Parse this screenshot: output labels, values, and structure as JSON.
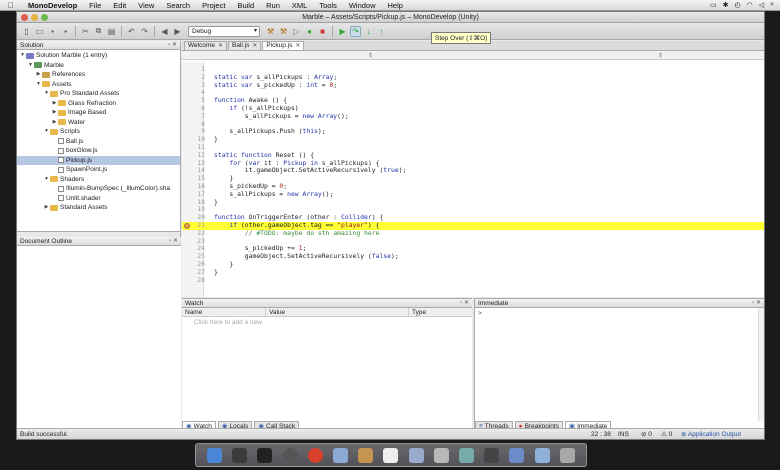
{
  "menubar": {
    "app": "MonoDevelop",
    "items": [
      "File",
      "Edit",
      "View",
      "Search",
      "Project",
      "Build",
      "Run",
      "XML",
      "Tools",
      "Window",
      "Help"
    ]
  },
  "window": {
    "title": "Marble – Assets/Scripts/Pickup.js – MonoDevelop (Unity)"
  },
  "toolbar": {
    "config": "Debug",
    "tooltip": "Step Over (⇧⌘O)"
  },
  "solution_pane": {
    "title": "Solution",
    "tree": [
      {
        "label": "Solution Marble (1 entry)",
        "depth": 0,
        "icon": "solution",
        "arrow": "▼"
      },
      {
        "label": "Marble",
        "depth": 1,
        "icon": "project",
        "arrow": "▼"
      },
      {
        "label": "References",
        "depth": 2,
        "icon": "references",
        "arrow": "▶"
      },
      {
        "label": "Assets",
        "depth": 2,
        "icon": "folder",
        "arrow": "▼"
      },
      {
        "label": "Pro Standard Assets",
        "depth": 3,
        "icon": "folder",
        "arrow": "▼"
      },
      {
        "label": "Glass Refraction",
        "depth": 4,
        "icon": "folder",
        "arrow": "▶"
      },
      {
        "label": "Image Based",
        "depth": 4,
        "icon": "folder",
        "arrow": "▶"
      },
      {
        "label": "Water",
        "depth": 4,
        "icon": "folder",
        "arrow": "▶"
      },
      {
        "label": "Scripts",
        "depth": 3,
        "icon": "folder",
        "arrow": "▼"
      },
      {
        "label": "Ball.js",
        "depth": 4,
        "icon": "file",
        "arrow": ""
      },
      {
        "label": "boxGlow.js",
        "depth": 4,
        "icon": "file",
        "arrow": ""
      },
      {
        "label": "Pickup.js",
        "depth": 4,
        "icon": "file",
        "arrow": "",
        "selected": true
      },
      {
        "label": "SpawnPoint.js",
        "depth": 4,
        "icon": "file",
        "arrow": ""
      },
      {
        "label": "Shaders",
        "depth": 3,
        "icon": "folder",
        "arrow": "▼"
      },
      {
        "label": "Illumin-BumpSpec (_IllumColor).sha",
        "depth": 4,
        "icon": "file",
        "arrow": ""
      },
      {
        "label": "Unlit.shader",
        "depth": 4,
        "icon": "file",
        "arrow": ""
      },
      {
        "label": "Standard Assets",
        "depth": 3,
        "icon": "folder",
        "arrow": "▶"
      }
    ]
  },
  "outline_pane": {
    "title": "Document Outline"
  },
  "editor": {
    "tabs": [
      {
        "label": "Welcome",
        "active": false
      },
      {
        "label": "Ball.js",
        "active": false
      },
      {
        "label": "Pickup.js",
        "active": true
      }
    ],
    "lines": [
      {
        "n": "1",
        "t": ""
      },
      {
        "n": "2",
        "t": "static var s_allPickups : Array;"
      },
      {
        "n": "3",
        "t": "static var s_pickedUp : int = 0;"
      },
      {
        "n": "4",
        "t": ""
      },
      {
        "n": "5",
        "t": "function Awake () {"
      },
      {
        "n": "6",
        "t": "    if (!s_allPickups)"
      },
      {
        "n": "7",
        "t": "        s_allPickups = new Array();"
      },
      {
        "n": "8",
        "t": ""
      },
      {
        "n": "9",
        "t": "    s_allPickups.Push (this);"
      },
      {
        "n": "10",
        "t": "}"
      },
      {
        "n": "11",
        "t": ""
      },
      {
        "n": "12",
        "t": "static function Reset () {"
      },
      {
        "n": "13",
        "t": "    for (var it : Pickup in s_allPickups) {"
      },
      {
        "n": "14",
        "t": "        it.gameObject.SetActiveRecursively (true);"
      },
      {
        "n": "15",
        "t": "    }"
      },
      {
        "n": "16",
        "t": "    s_pickedUp = 0;"
      },
      {
        "n": "17",
        "t": "    s_allPickups = new Array();"
      },
      {
        "n": "18",
        "t": "}"
      },
      {
        "n": "19",
        "t": ""
      },
      {
        "n": "20",
        "t": "function OnTriggerEnter (other : Collider) {"
      },
      {
        "n": "21",
        "t": "    if (other.gameObject.tag == \"player\") {",
        "highlight": true
      },
      {
        "n": "22",
        "t": "        // #TODO: maybe do sth amazing here"
      },
      {
        "n": "23",
        "t": ""
      },
      {
        "n": "24",
        "t": "        s_pickedUp += 1;"
      },
      {
        "n": "25",
        "t": "        gameObject.SetActiveRecursively (false);"
      },
      {
        "n": "26",
        "t": "    }"
      },
      {
        "n": "27",
        "t": "}"
      },
      {
        "n": "28",
        "t": ""
      }
    ]
  },
  "watch": {
    "title": "Watch",
    "columns": [
      "Name",
      "Value",
      "Type"
    ],
    "placeholder": "Click here to add a new",
    "tabs": [
      "Watch",
      "Locals",
      "Call Stack"
    ]
  },
  "immediate": {
    "title": "Immediate",
    "prompt": ">",
    "tabs": [
      "Threads",
      "Breakpoints",
      "Immediate"
    ]
  },
  "status": {
    "message": "Build successful.",
    "position": "22 : 38",
    "mode": "INS",
    "errors": "0",
    "warnings": "0",
    "output": "Application Output"
  },
  "colors": {
    "highlight": "#ffff33",
    "selection": "#b5c7e3",
    "keyword": "#2233aa",
    "comment": "#3a8a3a"
  }
}
